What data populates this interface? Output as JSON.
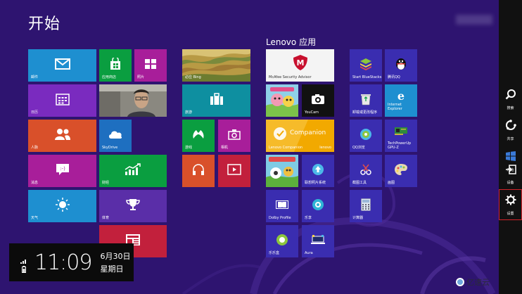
{
  "start": {
    "title": "开始"
  },
  "group": {
    "title": "Lenovo 应用"
  },
  "tiles": {
    "mail": "邮件",
    "store": "应用商店",
    "photos": "照片",
    "calendar": "日历",
    "camera_photo": "",
    "people": "人脉",
    "skydrive": "SkyDrive",
    "messaging": "消息",
    "finance": "财经",
    "weather": "天气",
    "sports": "体育",
    "news": "",
    "bing": "必应 Bing",
    "travel": "旅游",
    "games": "游戏",
    "camera": "相机",
    "music": "",
    "video": "",
    "mcafee": "McAfee Security Advisor",
    "kids_app": "",
    "youcam": "YouCam",
    "companion": "Lenovo Companion",
    "companion_logo": "Companion",
    "companion_sub": "lenovo",
    "kids_game": "",
    "lenovo_cloud": "联想照片系统",
    "dolby": "Dolby Profile",
    "ledong": "乐享",
    "leshang": "乐乐盒",
    "aura": "Aura",
    "bluestacks": "Start BlueStacks",
    "qq": "腾讯QQ",
    "uninstall": "卸载或更改程序",
    "ie": "Internet Explorer",
    "qq_browser": "QQ浏览",
    "gpuz": "TechPowerUp GPU-Z",
    "screenshot": "截图工具",
    "paint": "画图",
    "calc": "计算器"
  },
  "charms": {
    "search": "搜索",
    "share": "共享",
    "start": "开始",
    "devices": "设备",
    "settings": "设置"
  },
  "clock": {
    "time": "11:09",
    "date": "6月30日",
    "weekday": "星期日"
  },
  "watermark": {
    "text": "亿速云"
  },
  "colors": {
    "background": "#2e1470",
    "accent_blue": "#1e8fd0",
    "accent_green": "#0a9e40",
    "accent_orange": "#d9502a",
    "accent_purple": "#7a2bbf",
    "accent_magenta": "#a81e9a",
    "charm_highlight": "#d2232a"
  }
}
